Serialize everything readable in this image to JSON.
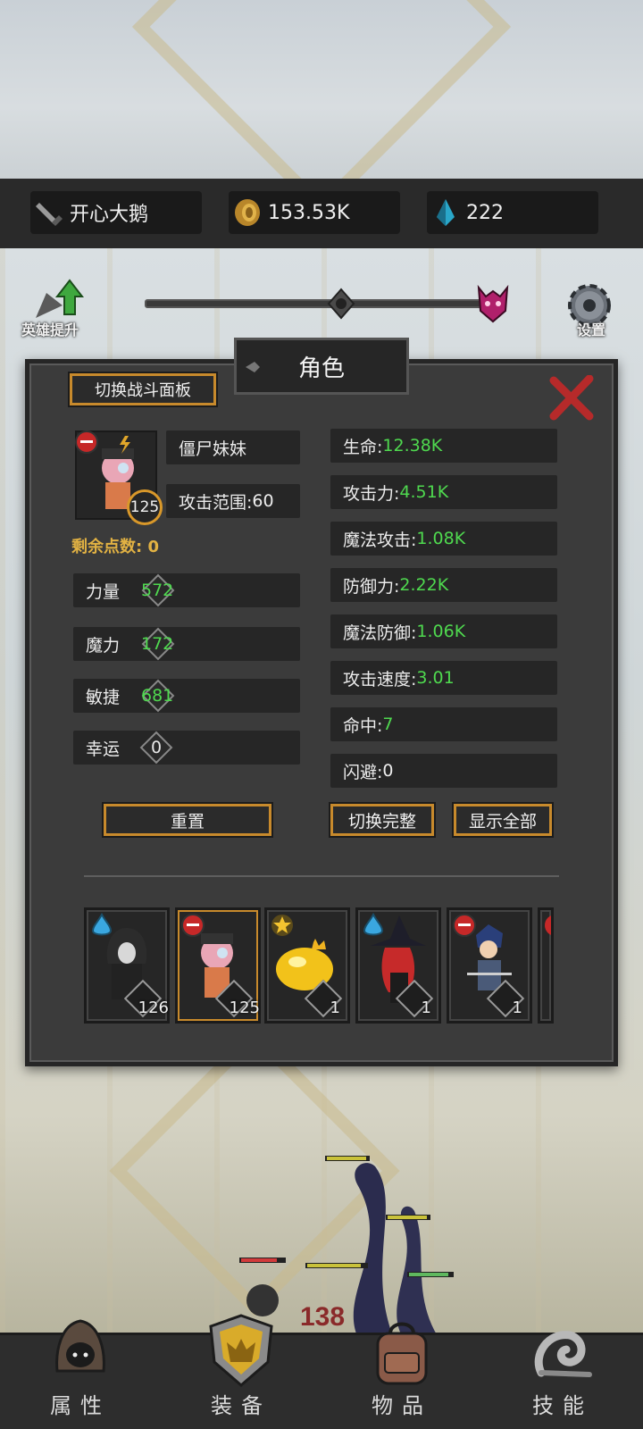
{
  "topbar": {
    "player_name": "开心大鹅",
    "gold": "153.53K",
    "gems": "222"
  },
  "controls": {
    "hero_upgrade_label": "英雄提升",
    "settings_label": "设置"
  },
  "panel": {
    "title": "角色",
    "switch_battle_panel": "切换战斗面板",
    "hero": {
      "name": "僵尸妹妹",
      "level": "125",
      "attack_range_label": "攻击范围:",
      "attack_range_value": "60",
      "remaining_points_label": "剩余点数:",
      "remaining_points_value": "0"
    },
    "attributes": [
      {
        "label": "力量",
        "value": "572",
        "color": "#4fd94f"
      },
      {
        "label": "魔力",
        "value": "172",
        "color": "#4fd94f"
      },
      {
        "label": "敏捷",
        "value": "681",
        "color": "#4fd94f"
      },
      {
        "label": "幸运",
        "value": "0",
        "color": "#e8e8e8"
      }
    ],
    "stats": [
      {
        "label": "生命:",
        "value": "12.38K",
        "color": "#4fd94f"
      },
      {
        "label": "攻击力:",
        "value": "4.51K",
        "color": "#4fd94f"
      },
      {
        "label": "魔法攻击:",
        "value": "1.08K",
        "color": "#4fd94f"
      },
      {
        "label": "防御力:",
        "value": "2.22K",
        "color": "#4fd94f"
      },
      {
        "label": "魔法防御:",
        "value": "1.06K",
        "color": "#4fd94f"
      },
      {
        "label": "攻击速度:",
        "value": "3.01",
        "color": "#4fd94f"
      },
      {
        "label": "命中:",
        "value": "7",
        "color": "#4fd94f"
      },
      {
        "label": "闪避:",
        "value": "0",
        "color": "#e8e8e8"
      }
    ],
    "buttons": {
      "reset": "重置",
      "switch_full": "切换完整",
      "show_all": "显示全部"
    },
    "heroes": [
      {
        "level": "126",
        "badge": "water-icon",
        "name": "hooded-rogue"
      },
      {
        "level": "125",
        "badge": "boxing-glove-icon",
        "name": "zombie-girl",
        "selected": true
      },
      {
        "level": "1",
        "badge": "star-icon",
        "name": "yellow-slime"
      },
      {
        "level": "1",
        "badge": "water-icon",
        "name": "red-witch"
      },
      {
        "level": "1",
        "badge": "boxing-glove-icon",
        "name": "blue-swordsman"
      }
    ]
  },
  "bottom_nav": [
    {
      "label": "属性",
      "icon": "hood-icon"
    },
    {
      "label": "装备",
      "icon": "shield-icon"
    },
    {
      "label": "物品",
      "icon": "backpack-icon"
    },
    {
      "label": "技能",
      "icon": "swirl-icon"
    }
  ]
}
